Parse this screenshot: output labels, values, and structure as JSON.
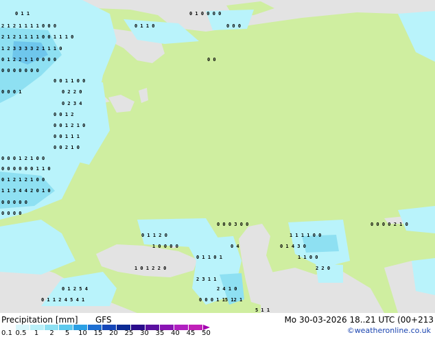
{
  "map": {
    "land_color": "#cfeea0",
    "sea_color": "#e3e3e3",
    "precip_colors": [
      "#b9f3fb",
      "#8ee0f2",
      "#6ec6ec"
    ]
  },
  "footer": {
    "legend_title": "Precipitation [mm]",
    "model": "GFS",
    "timestamp": "Mo 30-03-2026 18..21 UTC (00+213",
    "credit": "©weatheronline.co.uk",
    "scale_ticks": [
      "0.1",
      "0.5",
      "1",
      "2",
      "5",
      "10",
      "15",
      "20",
      "25",
      "30",
      "35",
      "40",
      "45",
      "50"
    ],
    "scale_colors": [
      "#fbfdfe",
      "#d9f6fb",
      "#b9f0f9",
      "#8ee0f2",
      "#5ecaee",
      "#2ba0e4",
      "#1e6fd2",
      "#1446b8",
      "#0c2a94",
      "#2a0c8c",
      "#5a10a0",
      "#8a14b4",
      "#b020c0",
      "#c020b8"
    ]
  },
  "values": {
    "r1": "0 1 1",
    "r2": "0 1 0 0 0 0",
    "r3": "0 0 0",
    "r4": "2 1 2 1 1 1 1 0 0 0",
    "r5": "0 1 1 0",
    "r6": "2 1 2 1 1 1 1 0 0 1 1 1 0",
    "r7": "1 2 3 3 3 3 2 1 1 1 0",
    "r8": "0 1 2 2 1 1 0 0 0 0",
    "r9": "0 0",
    "r10": "0 0 0 0 0 0 0",
    "r11": "0 0 1 1 0 0",
    "r12": "0 0 0 1",
    "r13": "0 2 2 0",
    "r14": "0 2 3 4",
    "r15": "0 0 1 2",
    "r16": "0 0 1 2 1 0",
    "r17": "0 0 1 1 1",
    "r18": "0 0 2 1 0",
    "r19": "0 0 0 1 2 1 0 0",
    "r20": "0 0 0 0 0 0 1 1 0",
    "r21": "0 1 2 1 2 1 0 0",
    "r22": "1 1 3 4 4 2 0 1 0",
    "r23": "0 0 0 0 0",
    "r24": "0 0 0 0",
    "r25": "0 0 0 3 0 0",
    "r26": "0 0 0 0 2 1 0",
    "r27": "0 1 1 2 0",
    "r28": "1 1 1 1 0 0",
    "r29": "1 0 0 0 0",
    "r30": "0 4",
    "r31": "0 1 4 3 0",
    "r32": "0 1 1 0 1",
    "r33": "1 1 0 0",
    "r34": "1 0 1 2 2 0",
    "r35": "2 2 0",
    "r36": "2 3 1 1",
    "r37": "0 1 2 5 4",
    "r38": "2 4 1 0",
    "r39": "0 1 1 2 4 5 4 1",
    "r40": "0 0 0 1 15 12 1",
    "r41": "5 1 1"
  }
}
